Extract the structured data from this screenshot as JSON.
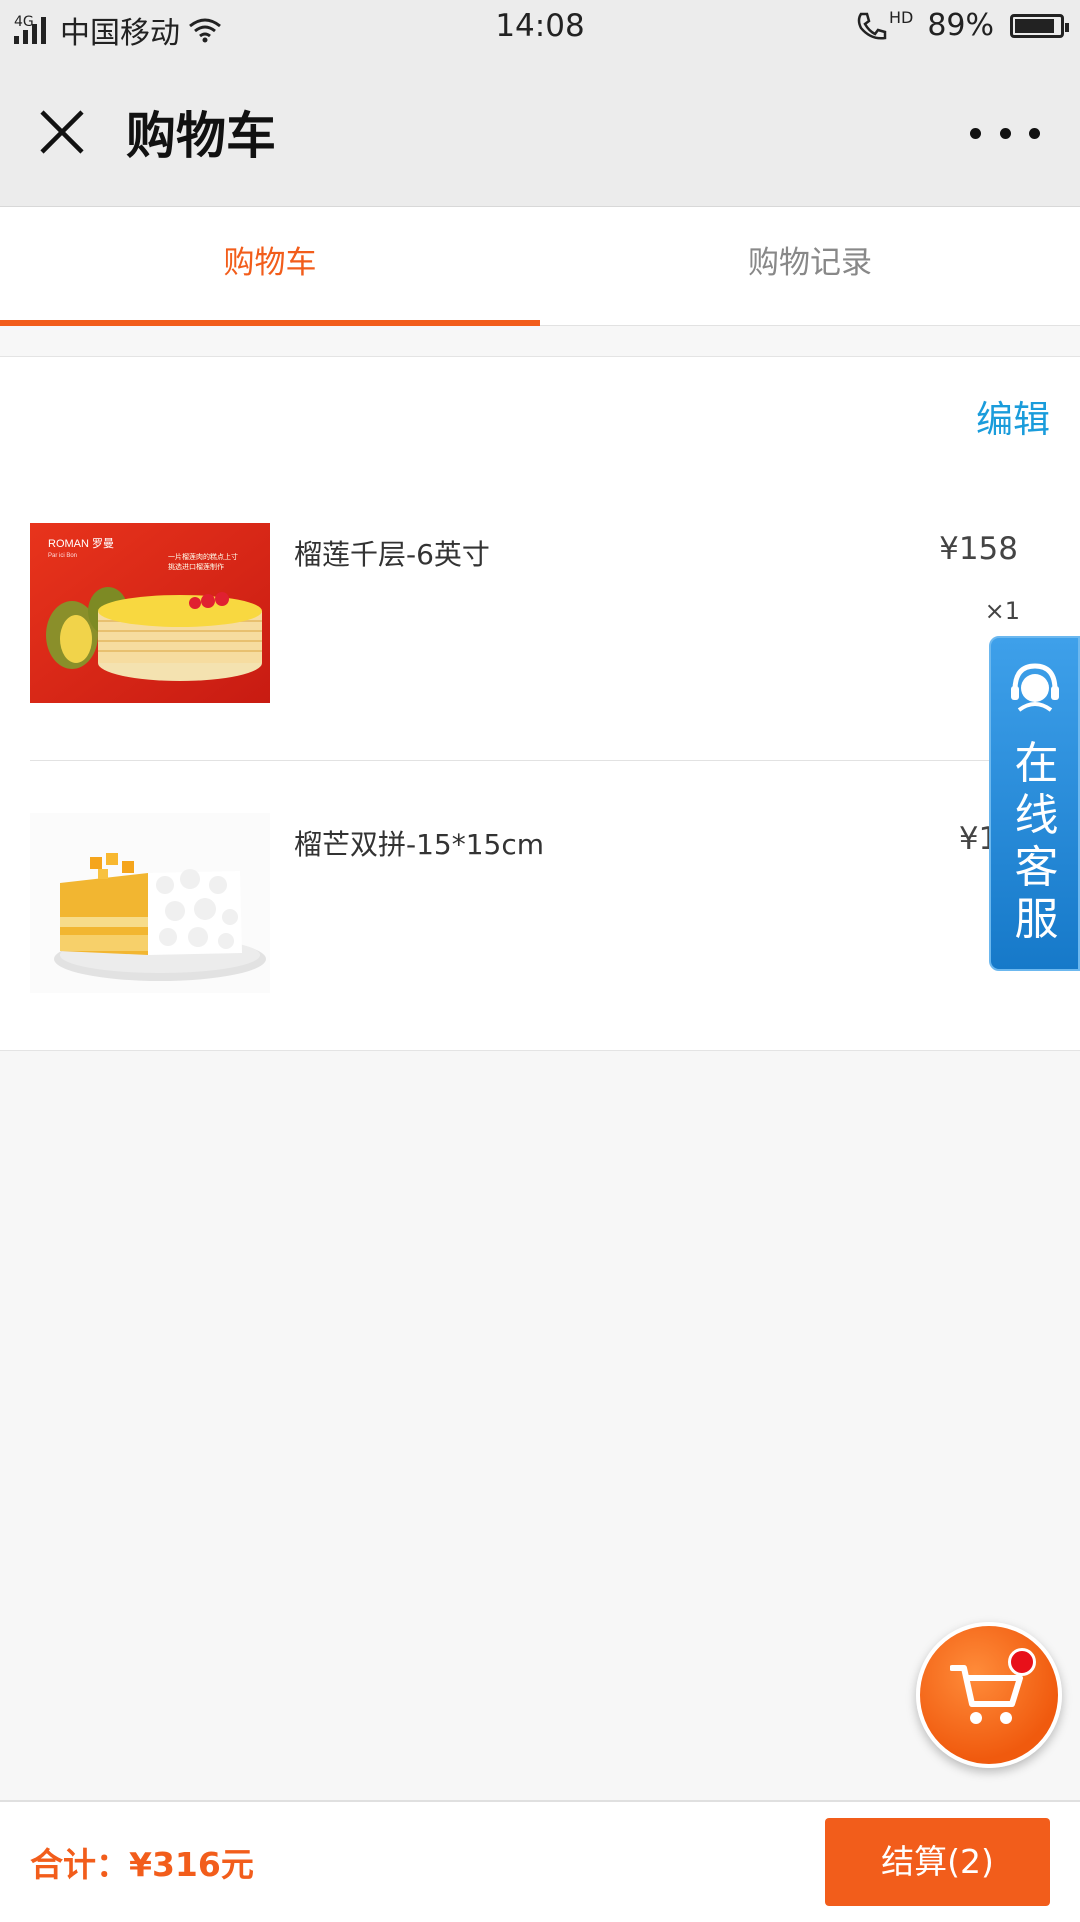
{
  "status_bar": {
    "network_type": "4G",
    "carrier": "中国移动",
    "time": "14:08",
    "hd_label": "HD",
    "battery_percent_text": "89%",
    "battery_level": 0.89
  },
  "nav": {
    "title": "购物车",
    "close_icon": "close-icon",
    "more_icon": "more-dots-icon"
  },
  "tabs": [
    {
      "label": "购物车",
      "active": true
    },
    {
      "label": "购物记录",
      "active": false
    }
  ],
  "cart": {
    "edit_label": "编辑",
    "items": [
      {
        "name": "榴莲千层-6英寸",
        "price": "¥158",
        "quantity": "×1",
        "thumb_brand": "ROMAN 罗曼",
        "thumb_brand_sub": "Par ici Bon",
        "thumb_slogan_1": "一片榴莲肉的糕点上寸",
        "thumb_slogan_2": "挑选进口榴莲制作"
      },
      {
        "name": "榴芒双拼-15*15cm",
        "price": "¥15",
        "quantity": ""
      }
    ]
  },
  "customer_service": {
    "label_chars": [
      "在",
      "线",
      "客",
      "服"
    ],
    "icon": "headset-agent-icon"
  },
  "floating_cart": {
    "icon": "shopping-cart-icon"
  },
  "bottom_bar": {
    "total_label": "合计：¥316元",
    "checkout_label": "结算(2)"
  },
  "colors": {
    "accent": "#f25d1b",
    "link": "#1a9cdb",
    "service_blue": "#1679c9"
  }
}
